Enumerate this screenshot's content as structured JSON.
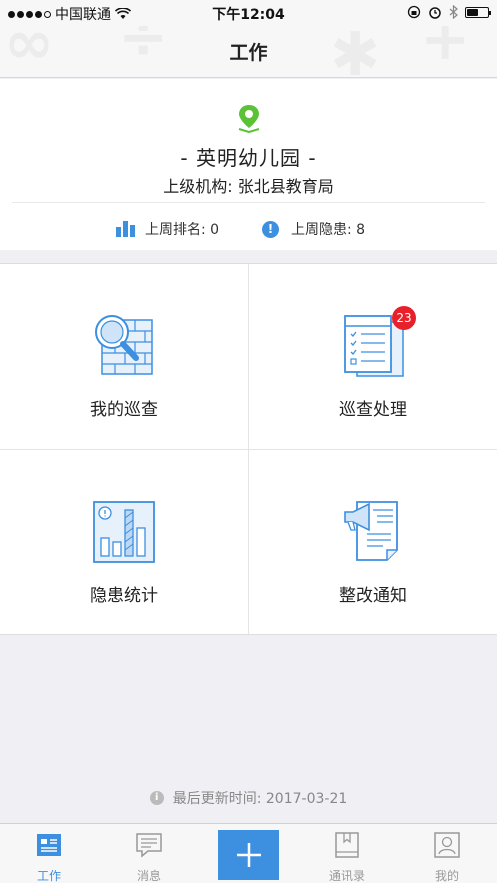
{
  "status_bar": {
    "carrier": "中国联通",
    "time": "下午12:04",
    "battery_level": 0.55
  },
  "nav": {
    "title": "工作"
  },
  "school": {
    "name": "- 英明幼儿园 -",
    "parent_org": "上级机构: 张北县教育局",
    "last_week_rank": "上周排名: 0",
    "last_week_hazards": "上周隐患: 8"
  },
  "grid": {
    "items": [
      {
        "label": "我的巡查",
        "icon": "magnifier-brick-wall-icon"
      },
      {
        "label": "巡查处理",
        "icon": "checklist-document-icon",
        "badge": "23"
      },
      {
        "label": "隐患统计",
        "icon": "bar-chart-stats-icon"
      },
      {
        "label": "整改通知",
        "icon": "megaphone-notice-icon"
      }
    ]
  },
  "footer": {
    "last_update": "最后更新时间: 2017-03-21"
  },
  "tabbar": {
    "tabs": [
      {
        "label": "工作",
        "icon": "work-card-icon",
        "active": true
      },
      {
        "label": "消息",
        "icon": "message-icon"
      },
      {
        "label": "",
        "icon": "plus-icon"
      },
      {
        "label": "通讯录",
        "icon": "contacts-book-icon"
      },
      {
        "label": "我的",
        "icon": "profile-icon"
      }
    ]
  },
  "colors": {
    "accent": "#3d8fe0",
    "badge": "#e8202a",
    "pin": "#5bc236"
  }
}
